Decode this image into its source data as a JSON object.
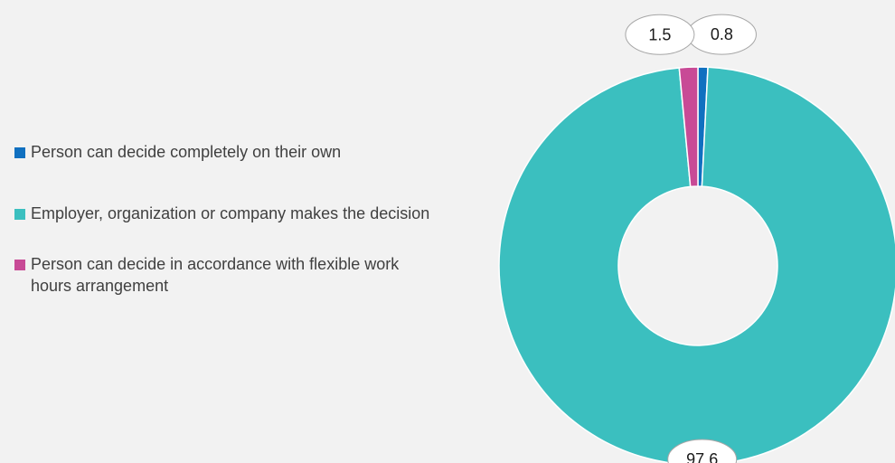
{
  "chart_data": {
    "type": "pie",
    "donut": true,
    "title": "",
    "labels": [
      "Person can decide completely on their own",
      "Employer, organization or company makes the decision",
      "Person can decide in accordance with flexible work hours arrangement"
    ],
    "values": [
      0.8,
      97.6,
      1.5
    ],
    "data_labels": [
      "0.8",
      "97.6",
      "1.5"
    ],
    "colors": [
      "#1070c0",
      "#3bbfbf",
      "#c84a96"
    ],
    "legend_position": "left"
  },
  "legend": {
    "items": [
      {
        "label": "Person can decide completely on their own",
        "color": "#1070c0"
      },
      {
        "label": "Employer, organization or company makes the decision",
        "color": "#3bbfbf"
      },
      {
        "label": "Person can decide in accordance with flexible work hours arrangement",
        "color": "#c84a96"
      }
    ]
  }
}
